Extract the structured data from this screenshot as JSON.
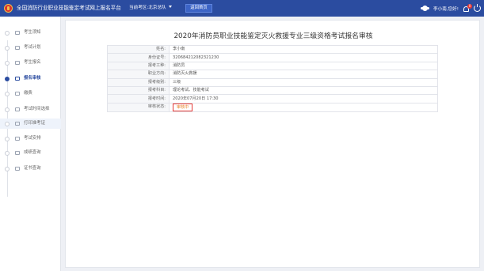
{
  "header": {
    "app_title": "全国消防行业职业技能鉴定考试网上报名平台",
    "exam_area_label": "当前考区:",
    "exam_area_value": "北京总队",
    "home_button": "返回首页",
    "user_greeting": "李小南,您好!",
    "notification_count": "0"
  },
  "sidebar": {
    "items": [
      {
        "label": "考生须知",
        "icon": "book-icon"
      },
      {
        "label": "考试计划",
        "icon": "calendar-icon"
      },
      {
        "label": "考生报名",
        "icon": "form-icon"
      },
      {
        "label": "报名审核",
        "icon": "review-icon"
      },
      {
        "label": "缴费",
        "icon": "payment-icon"
      },
      {
        "label": "考试时间选择",
        "icon": "clock-icon"
      },
      {
        "label": "打印准考证",
        "icon": "print-icon"
      },
      {
        "label": "考试安排",
        "icon": "schedule-icon"
      },
      {
        "label": "成绩查询",
        "icon": "search-icon"
      },
      {
        "label": "证书查询",
        "icon": "certificate-icon"
      }
    ],
    "active_index": 3
  },
  "main": {
    "title": "2020年消防员职业技能鉴定灭火救援专业三级资格考试报名审核",
    "rows": [
      {
        "label": "姓名:",
        "value": "李小南"
      },
      {
        "label": "身份证号:",
        "value": "320684212082321230"
      },
      {
        "label": "报考工种:",
        "value": "消防员"
      },
      {
        "label": "职业方向:",
        "value": "消防灭火救援"
      },
      {
        "label": "报考级别:",
        "value": "三级"
      },
      {
        "label": "报考科目:",
        "value": "理论考试、技能考试"
      },
      {
        "label": "报考时间:",
        "value": "2020年07月20日 17:30"
      }
    ],
    "status": {
      "label": "审核状态:",
      "value": "审核中"
    }
  },
  "colors": {
    "header_bg": "#2b4ca0",
    "status_border": "#e53935",
    "status_text": "#e8842a"
  }
}
